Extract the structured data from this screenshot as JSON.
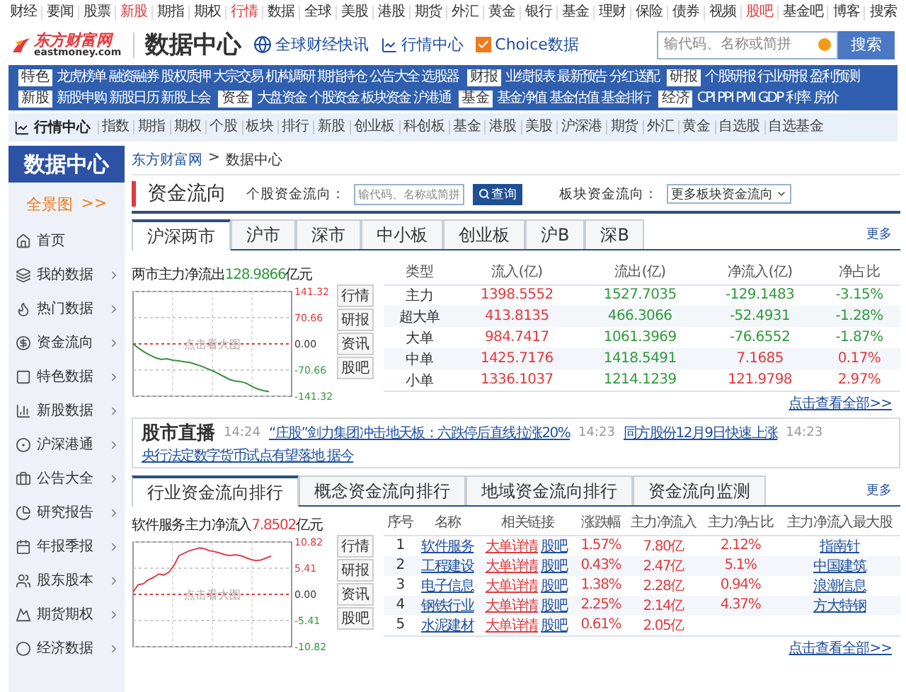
{
  "top_nav": [
    {
      "label": "财经",
      "highlighted": false
    },
    {
      "label": "要闻",
      "highlighted": false
    },
    {
      "label": "股票",
      "highlighted": false
    },
    {
      "label": "新股",
      "highlighted": true
    },
    {
      "label": "期指",
      "highlighted": false
    },
    {
      "label": "期权",
      "highlighted": false
    },
    {
      "label": "行情",
      "highlighted": true
    },
    {
      "label": "数据",
      "highlighted": false
    },
    {
      "label": "全球",
      "highlighted": false
    },
    {
      "label": "美股",
      "highlighted": false
    },
    {
      "label": "港股",
      "highlighted": false
    },
    {
      "label": "期货",
      "highlighted": false
    },
    {
      "label": "外汇",
      "highlighted": false
    },
    {
      "label": "黄金",
      "highlighted": false
    },
    {
      "label": "银行",
      "highlighted": false
    },
    {
      "label": "基金",
      "highlighted": false
    },
    {
      "label": "理财",
      "highlighted": false
    },
    {
      "label": "保险",
      "highlighted": false
    },
    {
      "label": "债券",
      "highlighted": false
    },
    {
      "label": "视频",
      "highlighted": false
    },
    {
      "label": "股吧",
      "highlighted": true
    },
    {
      "label": "基金吧",
      "highlighted": false
    },
    {
      "label": "博客",
      "highlighted": false
    },
    {
      "label": "搜索",
      "highlighted": false
    }
  ],
  "header": {
    "logo": {
      "name": "东方财富网",
      "domain": "eastmoney.com"
    },
    "title": "数据中心",
    "links": [
      {
        "label": "全球财经快讯",
        "kind": "globe"
      },
      {
        "label": "行情中心",
        "kind": "chart"
      },
      {
        "label": "Choice数据",
        "kind": "checkbox",
        "checked": true
      }
    ],
    "search": {
      "placeholder": "输代码、名称或简拼",
      "button": "搜索"
    }
  },
  "category_menu": [
    [
      {
        "tag": "特色",
        "links": [
          "龙虎榜单",
          "融资融券",
          "股权质押",
          "大宗交易",
          "机构调研",
          "期指持仓",
          "公告大全",
          "选股器"
        ]
      },
      {
        "tag": "财报",
        "links": [
          "业绩报表",
          "最新预告",
          "分红送配"
        ]
      },
      {
        "tag": "研报",
        "links": [
          "个股研报",
          "行业研报",
          "盈利预测"
        ]
      }
    ],
    [
      {
        "tag": "新股",
        "links": [
          "新股申购",
          "新股日历",
          "新股上会"
        ]
      },
      {
        "tag": "资金",
        "links": [
          "大盘资金",
          "个股资金",
          "板块资金",
          "沪港通"
        ]
      },
      {
        "tag": "基金",
        "links": [
          "基金净值",
          "基金估值",
          "基金排行"
        ]
      },
      {
        "tag": "经济",
        "links": [
          "CPI",
          "PPI",
          "PMI",
          "GDP",
          "利率",
          "房价"
        ]
      }
    ]
  ],
  "sub_nav": {
    "title": "行情中心",
    "items": [
      "指数",
      "期指",
      "期权",
      "个股",
      "板块",
      "排行",
      "新股",
      "创业板",
      "科创板",
      "基金",
      "港股",
      "美股",
      "沪深港",
      "期货",
      "外汇",
      "黄金",
      "自选股",
      "自选基金"
    ]
  },
  "sidebar": {
    "title": "数据中心",
    "overview": {
      "label": "全景图",
      "arrow": ">>"
    },
    "items": [
      {
        "label": "首页",
        "has_arrow": false
      },
      {
        "label": "我的数据",
        "has_arrow": true
      },
      {
        "label": "热门数据",
        "has_arrow": true
      },
      {
        "label": "资金流向",
        "has_arrow": true
      },
      {
        "label": "特色数据",
        "has_arrow": true
      },
      {
        "label": "新股数据",
        "has_arrow": true
      },
      {
        "label": "沪深港通",
        "has_arrow": true
      },
      {
        "label": "公告大全",
        "has_arrow": true
      },
      {
        "label": "研究报告",
        "has_arrow": true
      },
      {
        "label": "年报季报",
        "has_arrow": true
      },
      {
        "label": "股东股本",
        "has_arrow": true
      },
      {
        "label": "期货期权",
        "has_arrow": true
      },
      {
        "label": "经济数据",
        "has_arrow": true
      }
    ]
  },
  "breadcrumb": {
    "items": [
      "东方财富网",
      "数据中心"
    ],
    "separator": ">"
  },
  "fund_flow": {
    "title": "资金流向",
    "stock_query": {
      "label": "个股资金流向：",
      "placeholder": "输代码、名称或简拼",
      "button": "查询"
    },
    "sector_select": {
      "label": "板块资金流向：",
      "value": "更多板块资金流向"
    },
    "tabs": [
      {
        "label": "沪深两市",
        "selected": true
      },
      {
        "label": "沪市",
        "selected": false
      },
      {
        "label": "深市",
        "selected": false
      },
      {
        "label": "中小板",
        "selected": false
      },
      {
        "label": "创业板",
        "selected": false
      },
      {
        "label": "沪B",
        "selected": false
      },
      {
        "label": "深B",
        "selected": false
      }
    ],
    "more": "更多",
    "chart": {
      "label": "两市主力净流出",
      "value": "128.9866",
      "unit": "亿元",
      "rising": false,
      "hint": "点击看大图",
      "chart_data": {
        "type": "line",
        "ylim": [
          -141.32,
          141.32
        ],
        "grid": true,
        "ref_lines": [
          {
            "axis": "y",
            "value": 0,
            "color": "#e4393c"
          }
        ],
        "yticks": [
          {
            "value": 141.32,
            "label": "141.32"
          },
          {
            "value": 70.66,
            "label": "70.66"
          },
          {
            "value": 0,
            "label": "0.00"
          },
          {
            "value": -70.66,
            "label": "-70.66"
          },
          {
            "value": -141.32,
            "label": "-141.32"
          }
        ],
        "series": [
          {
            "color": "#3d8b3d",
            "values": [
              0,
              -12,
              -22,
              -30,
              -38,
              -42,
              -40,
              -44,
              -46,
              -48,
              -50,
              -55,
              -60,
              -66,
              -72,
              -80,
              -88,
              -96,
              -100,
              -102,
              -106,
              -115,
              -122,
              -126,
              -129
            ]
          }
        ]
      }
    },
    "chart_buttons": [
      "行情",
      "研报",
      "资讯",
      "股吧"
    ],
    "table": {
      "columns": [
        "类型",
        "流入(亿)",
        "流出(亿)",
        "净流入(亿)",
        "净占比"
      ],
      "rows": [
        {
          "type": "主力",
          "inflow": "1398.5552",
          "outflow": "1527.7035",
          "net": "-129.1483",
          "ratio": "-3.15%",
          "rising": false
        },
        {
          "type": "超大单",
          "inflow": "413.8135",
          "outflow": "466.3066",
          "net": "-52.4931",
          "ratio": "-1.28%",
          "rising": false
        },
        {
          "type": "大单",
          "inflow": "984.7417",
          "outflow": "1061.3969",
          "net": "-76.6552",
          "ratio": "-1.87%",
          "rising": false
        },
        {
          "type": "中单",
          "inflow": "1425.7176",
          "outflow": "1418.5491",
          "net": "7.1685",
          "ratio": "0.17%",
          "rising": true
        },
        {
          "type": "小单",
          "inflow": "1336.1037",
          "outflow": "1214.1239",
          "net": "121.9798",
          "ratio": "2.97%",
          "rising": true
        }
      ]
    },
    "view_all": "点击查看全部>>"
  },
  "live": {
    "title": "股市直播",
    "items": [
      {
        "time": "14:24",
        "text": "“庄股”剑力集团冲击地天板：六跌停后直线拉涨20%"
      },
      {
        "time": "14:23",
        "text": "同方股份12月9日快速上涨"
      },
      {
        "time": "14:23",
        "text": "央行法定数字货币试点有望落地 据今"
      }
    ]
  },
  "ranking": {
    "tabs": [
      {
        "label": "行业资金流向排行",
        "selected": true
      },
      {
        "label": "概念资金流向排行",
        "selected": false
      },
      {
        "label": "地域资金流向排行",
        "selected": false
      },
      {
        "label": "资金流向监测",
        "selected": false
      }
    ],
    "more": "更多",
    "chart": {
      "label": "软件服务主力净流入",
      "value": "7.8502",
      "unit": "亿元",
      "rising": true,
      "hint": "点击看大图",
      "chart_data": {
        "type": "line",
        "ylim": [
          -10.82,
          10.82
        ],
        "grid": true,
        "ref_lines": [
          {
            "axis": "y",
            "value": 0,
            "color": "#e4393c"
          }
        ],
        "yticks": [
          {
            "value": 10.82,
            "label": "10.82"
          },
          {
            "value": 5.41,
            "label": "5.41"
          },
          {
            "value": 0,
            "label": "0.00"
          },
          {
            "value": -5.41,
            "label": "-5.41"
          },
          {
            "value": -10.82,
            "label": "-10.82"
          }
        ],
        "series": [
          {
            "color": "#e0404a",
            "values": [
              0.5,
              2,
              2.2,
              3,
              3.5,
              4.2,
              4,
              4.6,
              6,
              8,
              8.5,
              9,
              9.3,
              9.6,
              9.4,
              9,
              8.8,
              8.5,
              8.2,
              8,
              8.2,
              8,
              7.6,
              7.2,
              7,
              7.1,
              7.5,
              7.9
            ]
          }
        ]
      }
    },
    "chart_buttons": [
      "行情",
      "研报",
      "资讯",
      "股吧"
    ],
    "table": {
      "columns": [
        "序号",
        "名称",
        "相关链接",
        "涨跌幅",
        "主力净流入",
        "主力净占比",
        "主力净流入最大股"
      ],
      "rows": [
        {
          "index": "1",
          "name": "软件服务",
          "links": [
            "大单详情",
            "股吧"
          ],
          "change": "1.57%",
          "net_inflow": "7.80亿",
          "net_ratio": "2.12%",
          "top_stock": "指南针"
        },
        {
          "index": "2",
          "name": "工程建设",
          "links": [
            "大单详情",
            "股吧"
          ],
          "change": "0.43%",
          "net_inflow": "2.47亿",
          "net_ratio": "5.1%",
          "top_stock": "中国建筑"
        },
        {
          "index": "3",
          "name": "电子信息",
          "links": [
            "大单详情",
            "股吧"
          ],
          "change": "1.38%",
          "net_inflow": "2.28亿",
          "net_ratio": "0.94%",
          "top_stock": "浪潮信息"
        },
        {
          "index": "4",
          "name": "钢铁行业",
          "links": [
            "大单详情",
            "股吧"
          ],
          "change": "2.25%",
          "net_inflow": "2.14亿",
          "net_ratio": "4.37%",
          "top_stock": "方大特钢"
        },
        {
          "index": "5",
          "name": "水泥建材",
          "links": [
            "大单详情",
            "股吧"
          ],
          "change": "0.61%",
          "net_inflow": "2.05亿"
        }
      ]
    },
    "view_all": "点击查看全部>>"
  }
}
